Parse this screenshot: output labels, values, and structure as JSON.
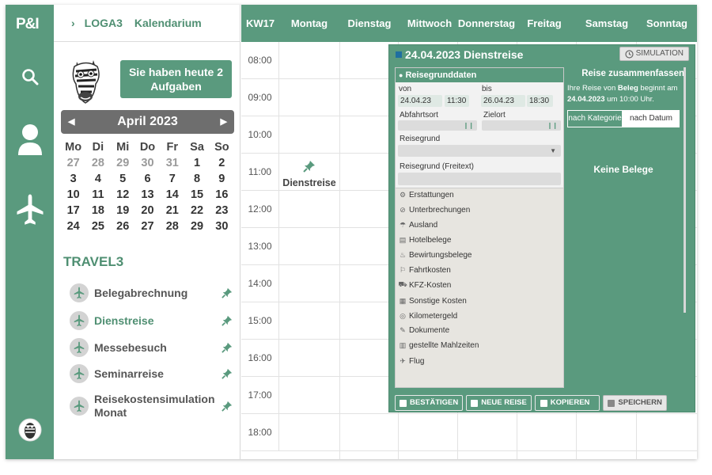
{
  "app": {
    "logo": "P&I"
  },
  "breadcrumb": {
    "item1": "LOGA3",
    "item2": "Kalendarium"
  },
  "tasks": {
    "label": "Sie haben heute 2 Aufgaben"
  },
  "calendar": {
    "month_label": "April 2023",
    "weekdays": [
      "Mo",
      "Di",
      "Mi",
      "Do",
      "Fr",
      "Sa",
      "So"
    ],
    "weeks": [
      [
        {
          "d": "27",
          "m": true
        },
        {
          "d": "28",
          "m": true
        },
        {
          "d": "29",
          "m": true
        },
        {
          "d": "30",
          "m": true
        },
        {
          "d": "31",
          "m": true
        },
        {
          "d": "1",
          "m": false
        },
        {
          "d": "2",
          "m": false
        }
      ],
      [
        {
          "d": "3",
          "m": false
        },
        {
          "d": "4",
          "m": false
        },
        {
          "d": "5",
          "m": false
        },
        {
          "d": "6",
          "m": false
        },
        {
          "d": "7",
          "m": false
        },
        {
          "d": "8",
          "m": false
        },
        {
          "d": "9",
          "m": false
        }
      ],
      [
        {
          "d": "10",
          "m": false
        },
        {
          "d": "11",
          "m": false
        },
        {
          "d": "12",
          "m": false
        },
        {
          "d": "13",
          "m": false
        },
        {
          "d": "14",
          "m": false
        },
        {
          "d": "15",
          "m": false
        },
        {
          "d": "16",
          "m": false
        }
      ],
      [
        {
          "d": "17",
          "m": false
        },
        {
          "d": "18",
          "m": false
        },
        {
          "d": "19",
          "m": false
        },
        {
          "d": "20",
          "m": false
        },
        {
          "d": "21",
          "m": false
        },
        {
          "d": "22",
          "m": false
        },
        {
          "d": "23",
          "m": false
        }
      ],
      [
        {
          "d": "24",
          "m": false
        },
        {
          "d": "25",
          "m": false
        },
        {
          "d": "26",
          "m": false
        },
        {
          "d": "27",
          "m": false
        },
        {
          "d": "28",
          "m": false
        },
        {
          "d": "29",
          "m": false
        },
        {
          "d": "30",
          "m": false
        }
      ]
    ]
  },
  "travel": {
    "title": "TRAVEL3",
    "items": [
      {
        "label": "Belegabrechnung",
        "active": false
      },
      {
        "label": "Dienstreise",
        "active": true
      },
      {
        "label": "Messebesuch",
        "active": false
      },
      {
        "label": "Seminarreise",
        "active": false
      },
      {
        "label": "Reisekostensimulation Monat",
        "active": false
      }
    ]
  },
  "week": {
    "kw": "KW17",
    "days": [
      "Montag",
      "Dienstag",
      "Mittwoch",
      "Donnerstag",
      "Freitag",
      "Samstag",
      "Sonntag"
    ],
    "times": [
      "08:00",
      "09:00",
      "10:00",
      "11:00",
      "12:00",
      "13:00",
      "14:00",
      "15:00",
      "16:00",
      "17:00",
      "18:00"
    ]
  },
  "event": {
    "label": "Dienstreise"
  },
  "modal": {
    "title": "24.04.2023 Dienstreise",
    "simulation_label": "SIMULATION",
    "section_title": "Reisegrunddaten",
    "von_label": "von",
    "bis_label": "bis",
    "von_date": "24.04.23",
    "von_time": "11:30",
    "bis_date": "26.04.23",
    "bis_time": "18:30",
    "abfahrtsort_label": "Abfahrtsort",
    "zielort_label": "Zielort",
    "reisegrund_label": "Reisegrund",
    "reisegrund_freitext_label": "Reisegrund (Freitext)",
    "menu": [
      "Erstattungen",
      "Unterbrechungen",
      "Ausland",
      "Hotelbelege",
      "Bewirtungsbelege",
      "Fahrtkosten",
      "KFZ-Kosten",
      "Sonstige Kosten",
      "Kilometergeld",
      "Dokumente",
      "gestellte Mahlzeiten",
      "Flug"
    ],
    "summary_title": "Reise zusammenfassen",
    "summary_text_1": "Ihre Reise von ",
    "summary_text_bold1": "Beleg",
    "summary_text_2": " beginnt am ",
    "summary_text_bold2": "24.04.2023",
    "summary_text_3": " um 10:00 Uhr.",
    "tab_category": "nach Kategorie",
    "tab_date": "nach Datum",
    "empty_label": "Keine Belege",
    "buttons": {
      "confirm": "BESTÄTIGEN",
      "new": "NEUE REISE",
      "copy": "KOPIEREN",
      "save": "SPEICHERN"
    }
  },
  "colors": {
    "brand": "#5a9a7e",
    "text_green": "#4f8f72"
  }
}
